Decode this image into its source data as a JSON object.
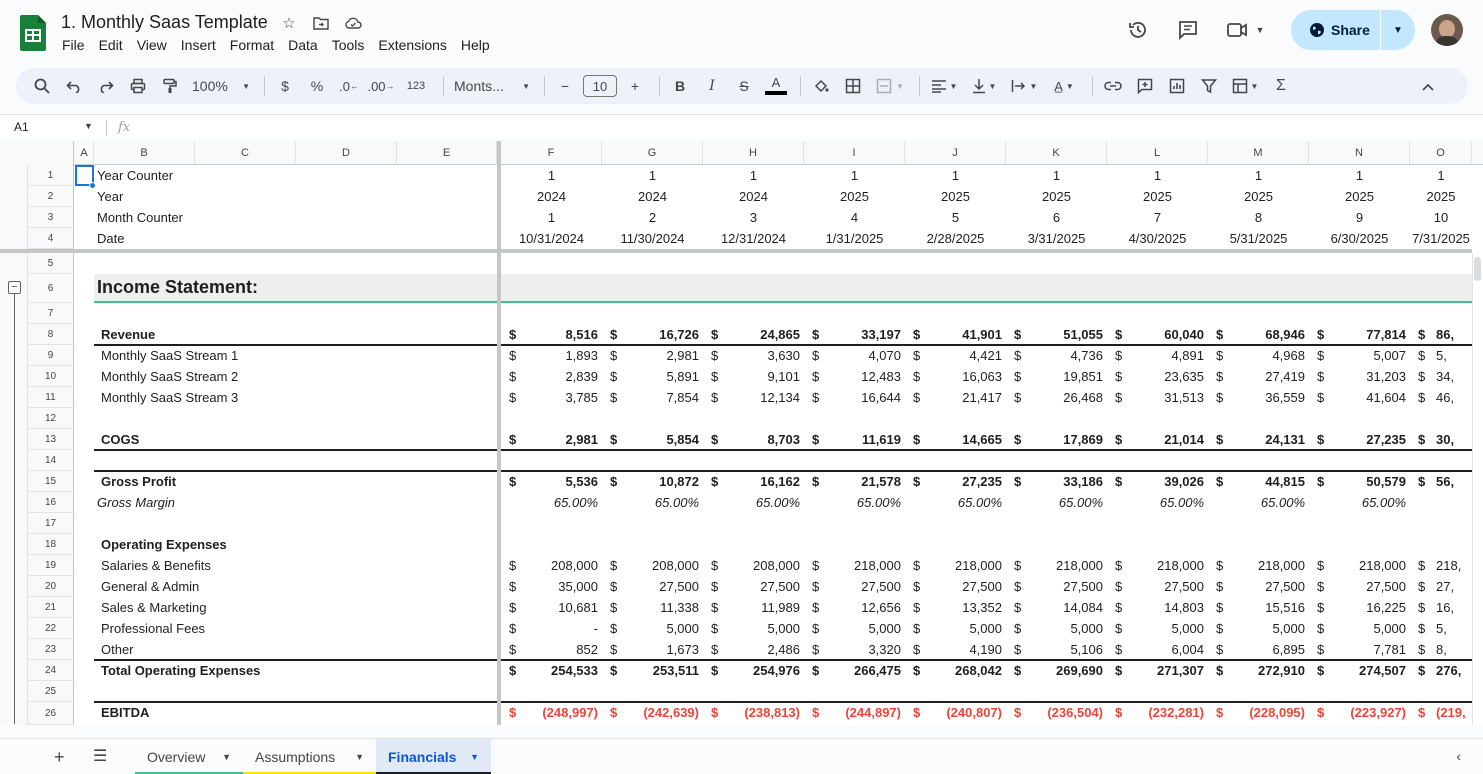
{
  "document": {
    "title": "1. Monthly Saas Template",
    "menu": [
      "File",
      "Edit",
      "View",
      "Insert",
      "Format",
      "Data",
      "Tools",
      "Extensions",
      "Help"
    ],
    "share_label": "Share"
  },
  "toolbar": {
    "zoom": "100%",
    "currency": "$",
    "percent": "%",
    "decrease_decimal": ".0",
    "increase_decimal": ".00",
    "number_format": "123",
    "font": "Monts...",
    "font_size": "10",
    "bold": "B",
    "italic": "I",
    "text_color": "A",
    "sum": "Σ"
  },
  "formula_bar": {
    "cell_ref": "A1",
    "fx": "fx",
    "value": ""
  },
  "columns": [
    "A",
    "B",
    "C",
    "D",
    "E",
    "F",
    "G",
    "H",
    "I",
    "J",
    "K",
    "L",
    "M",
    "N",
    "O"
  ],
  "rows": [
    "1",
    "2",
    "3",
    "4",
    "5",
    "6",
    "7",
    "8",
    "9",
    "10",
    "11",
    "12",
    "13",
    "14",
    "15",
    "16",
    "17",
    "18",
    "19",
    "20",
    "21",
    "22",
    "23",
    "24",
    "25",
    "26"
  ],
  "header_rows": {
    "year_counter": {
      "label": "Year Counter",
      "values": [
        "1",
        "1",
        "1",
        "1",
        "1",
        "1",
        "1",
        "1",
        "1",
        "1"
      ]
    },
    "year": {
      "label": "Year",
      "values": [
        "2024",
        "2024",
        "2024",
        "2025",
        "2025",
        "2025",
        "2025",
        "2025",
        "2025",
        "2025"
      ]
    },
    "month_counter": {
      "label": "Month Counter",
      "values": [
        "1",
        "2",
        "3",
        "4",
        "5",
        "6",
        "7",
        "8",
        "9",
        "10"
      ]
    },
    "date": {
      "label": "Date",
      "values": [
        "10/31/2024",
        "11/30/2024",
        "12/31/2024",
        "1/31/2025",
        "2/28/2025",
        "3/31/2025",
        "4/30/2025",
        "5/31/2025",
        "6/30/2025",
        "7/31/2025"
      ]
    }
  },
  "section_title": "Income Statement:",
  "statement_rows": [
    {
      "row": 8,
      "label": "Revenue",
      "style": "bold",
      "values": [
        "8,516",
        "16,726",
        "24,865",
        "33,197",
        "41,901",
        "51,055",
        "60,040",
        "68,946",
        "77,814",
        "86,"
      ],
      "dollar": true
    },
    {
      "row": 9,
      "label": "Monthly SaaS Stream 1",
      "style": "normal",
      "values": [
        "1,893",
        "2,981",
        "3,630",
        "4,070",
        "4,421",
        "4,736",
        "4,891",
        "4,968",
        "5,007",
        "5,"
      ],
      "dollar": true
    },
    {
      "row": 10,
      "label": "Monthly SaaS Stream 2",
      "style": "normal",
      "values": [
        "2,839",
        "5,891",
        "9,101",
        "12,483",
        "16,063",
        "19,851",
        "23,635",
        "27,419",
        "31,203",
        "34,"
      ],
      "dollar": true
    },
    {
      "row": 11,
      "label": "Monthly SaaS Stream 3",
      "style": "normal",
      "values": [
        "3,785",
        "7,854",
        "12,134",
        "16,644",
        "21,417",
        "26,468",
        "31,513",
        "36,559",
        "41,604",
        "46,"
      ],
      "dollar": true
    },
    {
      "row": 13,
      "label": "COGS",
      "style": "bold",
      "values": [
        "2,981",
        "5,854",
        "8,703",
        "11,619",
        "14,665",
        "17,869",
        "21,014",
        "24,131",
        "27,235",
        "30,"
      ],
      "dollar": true
    },
    {
      "row": 15,
      "label": "Gross Profit",
      "style": "bold",
      "values": [
        "5,536",
        "10,872",
        "16,162",
        "21,578",
        "27,235",
        "33,186",
        "39,026",
        "44,815",
        "50,579",
        "56,"
      ],
      "dollar": true
    },
    {
      "row": 16,
      "label": "Gross Margin",
      "style": "italic",
      "values": [
        "65.00%",
        "65.00%",
        "65.00%",
        "65.00%",
        "65.00%",
        "65.00%",
        "65.00%",
        "65.00%",
        "65.00%",
        ""
      ],
      "dollar": false
    },
    {
      "row": 18,
      "label": "Operating Expenses",
      "style": "bold",
      "values": [],
      "dollar": false
    },
    {
      "row": 19,
      "label": "Salaries & Benefits",
      "style": "normal",
      "values": [
        "208,000",
        "208,000",
        "208,000",
        "218,000",
        "218,000",
        "218,000",
        "218,000",
        "218,000",
        "218,000",
        "218,"
      ],
      "dollar": true
    },
    {
      "row": 20,
      "label": "General & Admin",
      "style": "normal",
      "values": [
        "35,000",
        "27,500",
        "27,500",
        "27,500",
        "27,500",
        "27,500",
        "27,500",
        "27,500",
        "27,500",
        "27,"
      ],
      "dollar": true
    },
    {
      "row": 21,
      "label": "Sales & Marketing",
      "style": "normal",
      "values": [
        "10,681",
        "11,338",
        "11,989",
        "12,656",
        "13,352",
        "14,084",
        "14,803",
        "15,516",
        "16,225",
        "16,"
      ],
      "dollar": true
    },
    {
      "row": 22,
      "label": "Professional Fees",
      "style": "normal",
      "values": [
        "-",
        "5,000",
        "5,000",
        "5,000",
        "5,000",
        "5,000",
        "5,000",
        "5,000",
        "5,000",
        "5,"
      ],
      "dollar": true
    },
    {
      "row": 23,
      "label": "Other",
      "style": "normal",
      "values": [
        "852",
        "1,673",
        "2,486",
        "3,320",
        "4,190",
        "5,106",
        "6,004",
        "6,895",
        "7,781",
        "8,"
      ],
      "dollar": true
    },
    {
      "row": 24,
      "label": "Total Operating Expenses",
      "style": "bold",
      "values": [
        "254,533",
        "253,511",
        "254,976",
        "266,475",
        "268,042",
        "269,690",
        "271,307",
        "272,910",
        "274,507",
        "276,"
      ],
      "dollar": true
    },
    {
      "row": 26,
      "label": "EBITDA",
      "style": "bold-red",
      "values": [
        "(248,997)",
        "(242,639)",
        "(238,813)",
        "(244,897)",
        "(240,807)",
        "(236,504)",
        "(232,281)",
        "(228,095)",
        "(223,927)",
        "(219,"
      ],
      "dollar": true
    }
  ],
  "sheet_tabs": [
    {
      "label": "Overview",
      "color": "#46bd8b",
      "active": false
    },
    {
      "label": "Assumptions",
      "color": "#ffe000",
      "active": false
    },
    {
      "label": "Financials",
      "color": "#1f1f1f",
      "active": true
    }
  ],
  "colors": {
    "accent": "#1a73e8",
    "share_bg": "#c2e7ff",
    "section_line": "#46bd8b",
    "negative": "#e9453a"
  }
}
